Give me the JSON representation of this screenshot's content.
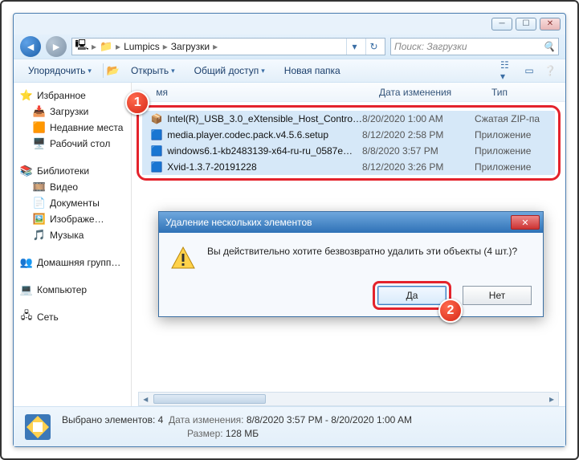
{
  "window": {
    "minimize": "─",
    "maximize": "☐",
    "close": "✕"
  },
  "address": {
    "crumbs": [
      "Lumpics",
      "Загрузки"
    ],
    "refresh": "↻",
    "search_placeholder": "Поиск: Загрузки"
  },
  "toolbar": {
    "organize": "Упорядочить",
    "open": "Открыть",
    "share": "Общий доступ",
    "newfolder": "Новая папка"
  },
  "sidebar": {
    "favorites": {
      "label": "Избранное",
      "items": [
        "Загрузки",
        "Недавние места",
        "Рабочий стол"
      ]
    },
    "libraries": {
      "label": "Библиотеки",
      "items": [
        "Видео",
        "Документы",
        "Изображе…",
        "Музыка"
      ]
    },
    "homegroup": {
      "label": "Домашняя групп…"
    },
    "computer": {
      "label": "Компьютер"
    },
    "network": {
      "label": "Сеть"
    }
  },
  "columns": {
    "name": "мя",
    "date": "Дата изменения",
    "type": "Тип"
  },
  "files": [
    {
      "name": "Intel(R)_USB_3.0_eXtensible_Host_Contro…",
      "date": "8/20/2020 1:00 AM",
      "type": "Сжатая ZIP-па",
      "icon": "📦"
    },
    {
      "name": "media.player.codec.pack.v4.5.6.setup",
      "date": "8/12/2020 2:58 PM",
      "type": "Приложение",
      "icon": "🟦"
    },
    {
      "name": "windows6.1-kb2483139-x64-ru-ru_0587e…",
      "date": "8/8/2020 3:57 PM",
      "type": "Приложение",
      "icon": "🟦"
    },
    {
      "name": "Xvid-1.3.7-20191228",
      "date": "8/12/2020 3:26 PM",
      "type": "Приложение",
      "icon": "🟦"
    }
  ],
  "dialog": {
    "title": "Удаление нескольких элементов",
    "message": "Вы действительно хотите безвозвратно удалить эти объекты (4 шт.)?",
    "yes": "Да",
    "no": "Нет"
  },
  "status": {
    "selected_label": "Выбрано элементов: 4",
    "date_label": "Дата изменения:",
    "date_value": "8/8/2020 3:57 PM - 8/20/2020 1:00 AM",
    "size_label": "Размер:",
    "size_value": "128 МБ"
  },
  "badges": {
    "one": "1",
    "two": "2"
  }
}
